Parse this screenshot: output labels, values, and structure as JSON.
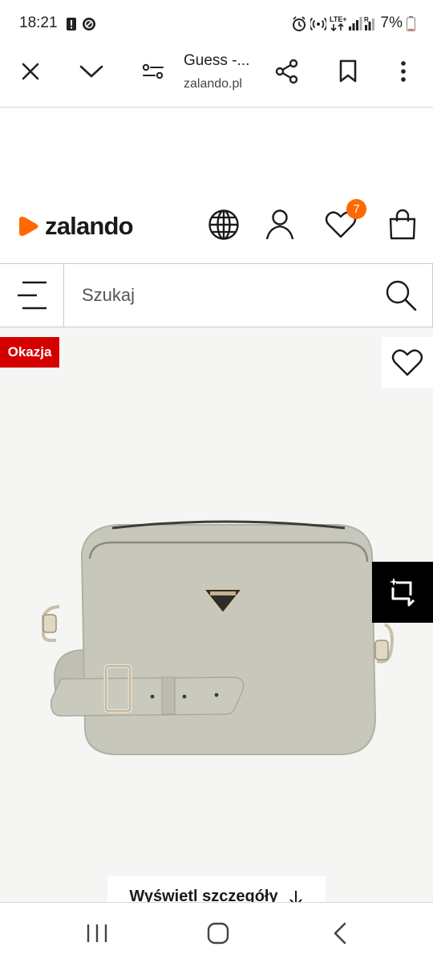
{
  "status_bar": {
    "time": "18:21",
    "battery": "7%",
    "icons": [
      "alert-icon",
      "blocked-icon",
      "alarm-icon",
      "hotspot-icon",
      "lte-icon",
      "signal-icon",
      "battery-icon"
    ]
  },
  "browser": {
    "tab_title": "Guess -...",
    "url": "zalando.pl",
    "icons": [
      "close-icon",
      "chevron-down-icon",
      "site-settings-icon",
      "share-icon",
      "bookmark-icon",
      "more-icon"
    ]
  },
  "header": {
    "logo_text": "zalando",
    "wishlist_count": "7",
    "brand_color": "#ff6900",
    "icons": [
      "globe-icon",
      "account-icon",
      "wishlist-icon",
      "bag-icon"
    ]
  },
  "search": {
    "placeholder": "Szukaj"
  },
  "product": {
    "badge": "Okazja",
    "badge_color": "#d40000",
    "details_button": "Wyświetl szczegóły",
    "image_description_icon": "crossbody-bag-image",
    "bag_color": "#c9c9bf"
  },
  "nav": {
    "icons": [
      "recent-apps-icon",
      "home-icon",
      "back-icon"
    ]
  }
}
